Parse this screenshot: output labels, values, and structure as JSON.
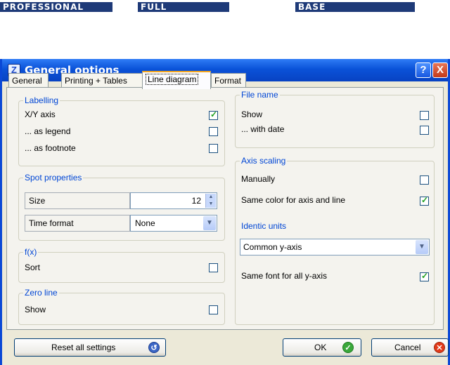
{
  "editions": [
    "PROFESSIONAL",
    "FULL",
    "BASE"
  ],
  "window": {
    "title": "General options",
    "help": "?",
    "close": "X"
  },
  "tabs": [
    "General",
    "Printing + Tables",
    "Line diagram",
    "Format"
  ],
  "labelling": {
    "title": "Labelling",
    "xy_axis": "X/Y axis",
    "as_legend": "... as legend",
    "as_footnote": "... as footnote"
  },
  "spot": {
    "title": "Spot properties",
    "size_label": "Size",
    "size_value": "12",
    "time_label": "Time format",
    "time_value": "None"
  },
  "fx": {
    "title": "f(x)",
    "sort": "Sort"
  },
  "zero_line": {
    "title": "Zero line",
    "show": "Show"
  },
  "file_name": {
    "title": "File name",
    "show": "Show",
    "with_date": "... with date"
  },
  "axis_scaling": {
    "title": "Axis scaling",
    "manually": "Manually",
    "same_color": "Same color for axis and line",
    "identic_units": "Identic units",
    "common_axis": "Common y-axis",
    "same_font": "Same font for all y-axis"
  },
  "buttons": {
    "reset": "Reset all settings",
    "ok": "OK",
    "cancel": "Cancel"
  },
  "colors": {
    "accent": "#0046d5",
    "titlebar": "#0a52d8",
    "check": "#21a121"
  }
}
